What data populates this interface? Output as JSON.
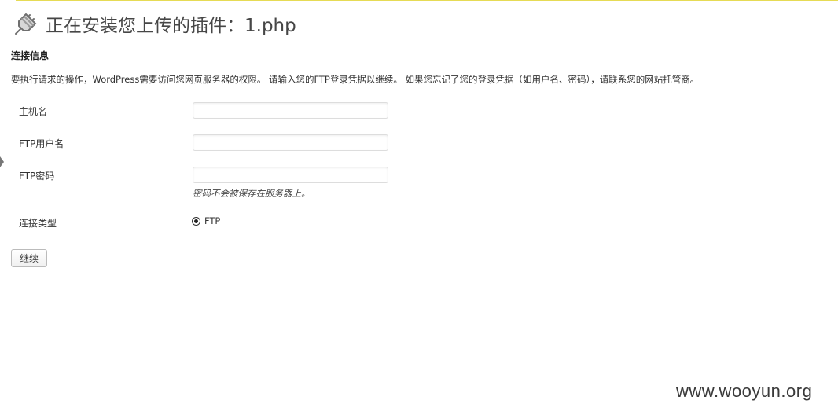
{
  "page": {
    "title": "正在安装您上传的插件：1.php",
    "section_title": "连接信息",
    "description": "要执行请求的操作，WordPress需要访问您网页服务器的权限。 请输入您的FTP登录凭据以继续。 如果您忘记了您的登录凭据（如用户名、密码），请联系您的网站托管商。"
  },
  "form": {
    "hostname_label": "主机名",
    "hostname_value": "",
    "username_label": "FTP用户名",
    "username_value": "",
    "password_label": "FTP密码",
    "password_value": "",
    "password_hint": "密码不会被保存在服务器上。",
    "connection_type_label": "连接类型",
    "connection_type_option": "FTP",
    "connection_type_selected": true,
    "continue_label": "继续"
  },
  "watermark": "www.wooyun.org",
  "colors": {
    "top_rule": "#e6db55",
    "title_text": "#464646"
  },
  "icons": {
    "title_icon": "plugin-plug-icon"
  }
}
